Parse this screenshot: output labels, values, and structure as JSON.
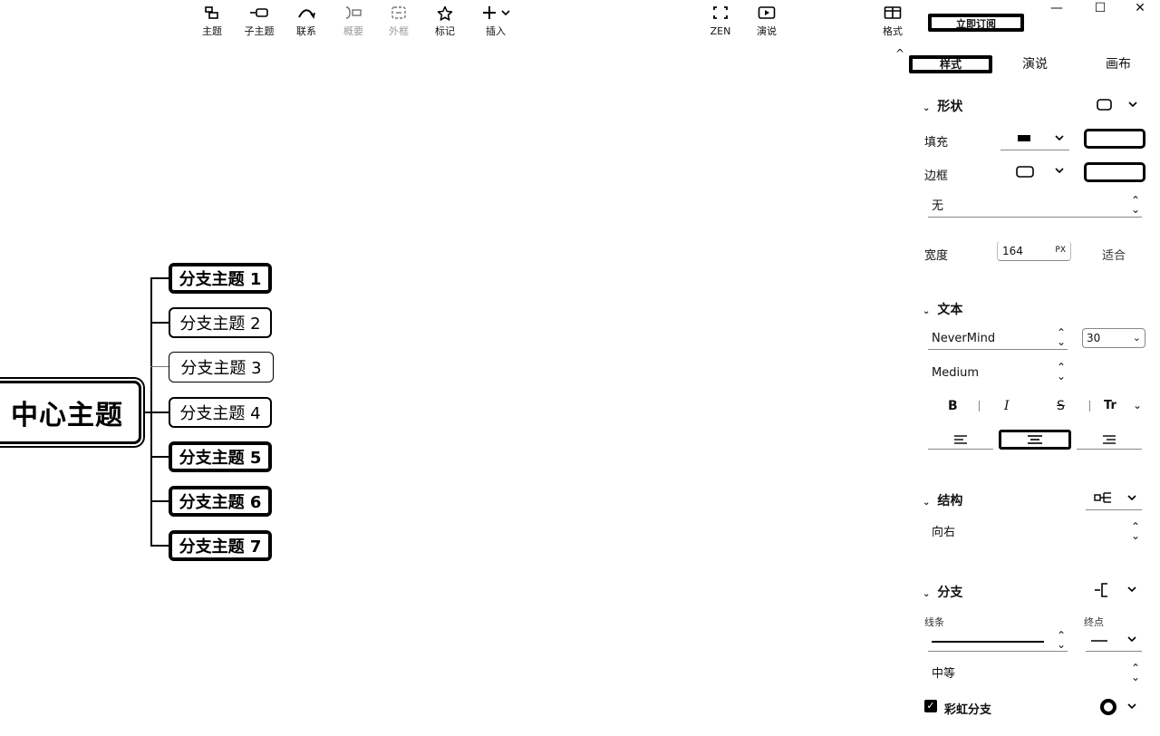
{
  "toolbar": {
    "items": [
      {
        "label": "主题",
        "icon": "topic-icon",
        "enabled": true
      },
      {
        "label": "子主题",
        "icon": "subtopic-icon",
        "enabled": true
      },
      {
        "label": "联系",
        "icon": "relationship-icon",
        "enabled": true
      },
      {
        "label": "概要",
        "icon": "summary-icon",
        "enabled": false
      },
      {
        "label": "外框",
        "icon": "boundary-icon",
        "enabled": false
      },
      {
        "label": "标记",
        "icon": "star-icon",
        "enabled": true
      },
      {
        "label": "插入",
        "icon": "plus-icon",
        "enabled": true
      }
    ],
    "zen_label": "ZEN",
    "present_label": "演说",
    "format_label": "格式",
    "subscribe_label": "立即订阅"
  },
  "window_controls": {
    "minimize": "—",
    "maximize": "☐",
    "close": "✕"
  },
  "mindmap": {
    "central": "中心主题",
    "branches": [
      {
        "label": "分支主题 1",
        "style": "bold"
      },
      {
        "label": "分支主题 2",
        "style": "normal"
      },
      {
        "label": "分支主题 3",
        "style": "thin"
      },
      {
        "label": "分支主题 4",
        "style": "normal"
      },
      {
        "label": "分支主题 5",
        "style": "bold"
      },
      {
        "label": "分支主题 6",
        "style": "bold"
      },
      {
        "label": "分支主题 7",
        "style": "bold"
      }
    ]
  },
  "panel": {
    "collapse_glyph": "^",
    "tabs": [
      "样式",
      "演说",
      "画布"
    ],
    "active_tab": "样式",
    "shape": {
      "title": "形状",
      "fill_label": "填充",
      "border_label": "边框",
      "border_style": "无",
      "width_label": "宽度",
      "width_value": "164",
      "width_unit": "PX",
      "fit_label": "适合"
    },
    "text": {
      "title": "文本",
      "font": "NeverMind",
      "size": "30",
      "weight": "Medium",
      "bold": "B",
      "italic": "I",
      "strike": "S",
      "case": "Tr"
    },
    "structure": {
      "title": "结构",
      "direction": "向右"
    },
    "branch": {
      "title": "分支",
      "line_label": "线条",
      "end_label": "终点",
      "thickness": "中等",
      "rainbow_label": "彩虹分支",
      "rainbow_checked": true
    }
  }
}
